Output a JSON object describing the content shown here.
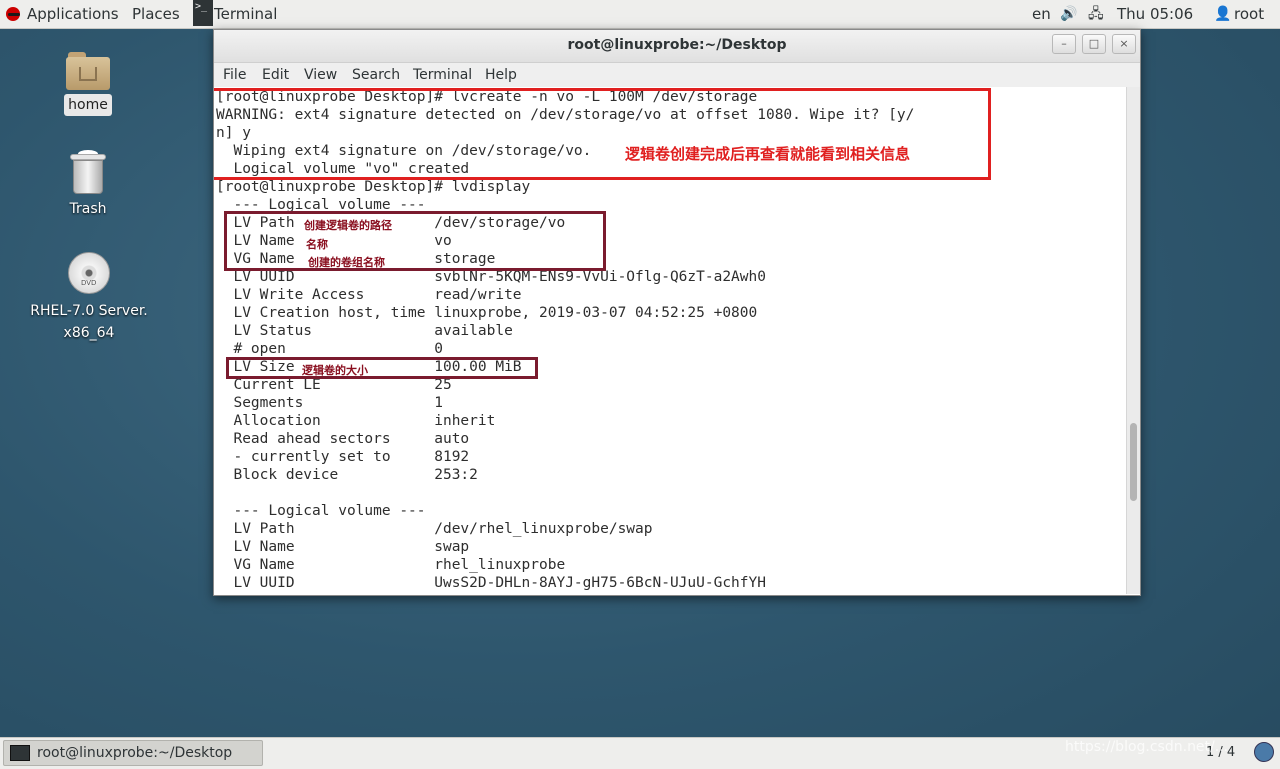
{
  "top_panel": {
    "applications": "Applications",
    "places": "Places",
    "task_terminal": "Terminal",
    "lang": "en",
    "clock": "Thu 05:06",
    "user": "root"
  },
  "desktop": {
    "home": "home",
    "trash": "Trash",
    "disc_line1": "RHEL-7.0 Server.",
    "disc_line2": "x86_64",
    "disc_text": "DVD"
  },
  "window": {
    "title": "root@linuxprobe:~/Desktop",
    "min_glyph": "–",
    "max_glyph": "□",
    "close_glyph": "×"
  },
  "menu": [
    "File",
    "Edit",
    "View",
    "Search",
    "Terminal",
    "Help"
  ],
  "terminal_lines": [
    "[root@linuxprobe Desktop]# lvcreate -n vo -L 100M /dev/storage",
    "WARNING: ext4 signature detected on /dev/storage/vo at offset 1080. Wipe it? [y/",
    "n] y",
    "  Wiping ext4 signature on /dev/storage/vo.",
    "  Logical volume \"vo\" created",
    "[root@linuxprobe Desktop]# lvdisplay",
    "  --- Logical volume ---",
    "  LV Path                /dev/storage/vo",
    "  LV Name                vo",
    "  VG Name                storage",
    "  LV UUID                svblNr-5KQM-ENs9-VvUi-Oflg-Q6zT-a2Awh0",
    "  LV Write Access        read/write",
    "  LV Creation host, time linuxprobe, 2019-03-07 04:52:25 +0800",
    "  LV Status              available",
    "  # open                 0",
    "  LV Size                100.00 MiB",
    "  Current LE             25",
    "  Segments               1",
    "  Allocation             inherit",
    "  Read ahead sectors     auto",
    "  - currently set to     8192",
    "  Block device           253:2",
    "",
    "  --- Logical volume ---",
    "  LV Path                /dev/rhel_linuxprobe/swap",
    "  LV Name                swap",
    "  VG Name                rhel_linuxprobe",
    "  LV UUID                UwsS2D-DHLn-8AYJ-gH75-6BcN-UJuU-GchfYH"
  ],
  "annotations": {
    "created_note": "逻辑卷创建完成后再查看就能看到相关信息",
    "path_note": "创建逻辑卷的路径",
    "name_note": "名称",
    "vg_note": "创建的卷组名称",
    "size_note": "逻辑卷的大小"
  },
  "bottom_panel": {
    "task_label": "root@linuxprobe:~/Desktop",
    "pager": "1 / 4"
  },
  "watermark": "https://blog.csdn.net/...",
  "colors": {
    "annotation_red": "#e02020",
    "annotation_dark": "#7a1b2e",
    "desktop_bg": "#2e566d"
  }
}
